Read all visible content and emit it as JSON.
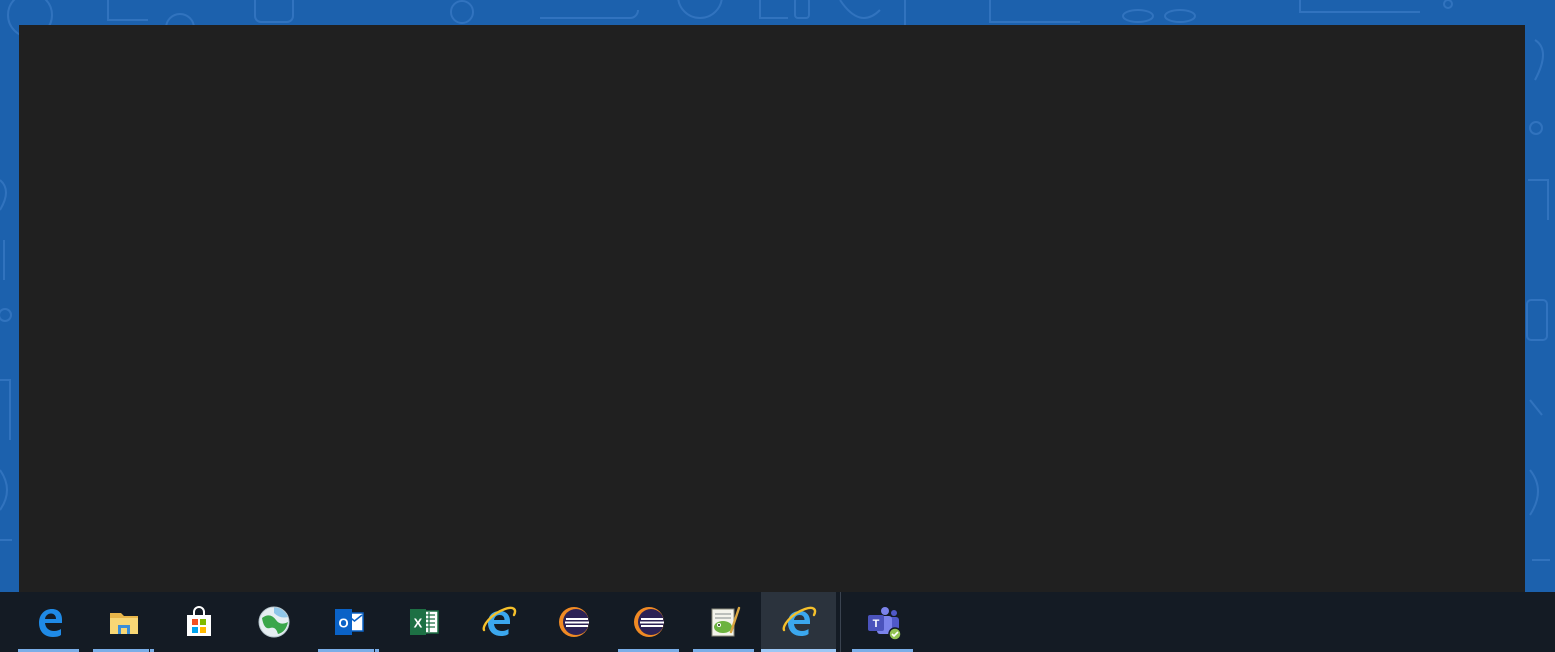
{
  "desktop": {
    "background_color": "#1c61ad",
    "window_color": "#202020"
  },
  "taskbar": {
    "background_color": "#141b24",
    "indicator_color": "#7aaee8",
    "items": [
      {
        "name": "edge-icon",
        "running": true,
        "active": false
      },
      {
        "name": "file-explorer-icon",
        "running": true,
        "active": false
      },
      {
        "name": "microsoft-store-icon",
        "running": false,
        "active": false
      },
      {
        "name": "globe-app-icon",
        "running": false,
        "active": false
      },
      {
        "name": "outlook-icon",
        "running": true,
        "active": false
      },
      {
        "name": "excel-icon",
        "running": false,
        "active": false
      },
      {
        "name": "internet-explorer-icon",
        "running": false,
        "active": false
      },
      {
        "name": "eclipse-icon",
        "running": false,
        "active": false
      },
      {
        "name": "eclipse-icon",
        "running": true,
        "active": false
      },
      {
        "name": "notepad-plus-plus-icon",
        "running": true,
        "active": false
      },
      {
        "name": "internet-explorer-icon",
        "running": true,
        "active": true
      },
      {
        "name": "teams-icon",
        "running": true,
        "active": false
      }
    ],
    "icon_labels": {
      "outlook_letter": "O",
      "excel_letter": "X",
      "teams_letter": "T"
    }
  }
}
